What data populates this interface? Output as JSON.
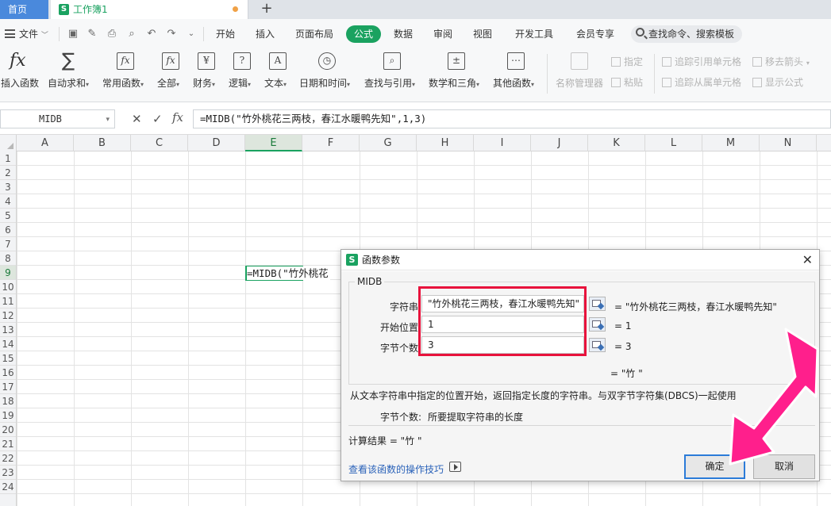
{
  "tabs": {
    "home": "首页",
    "doc_icon": "S",
    "doc_title": "工作簿1",
    "add": "+"
  },
  "menu": {
    "file": "文件",
    "items": [
      "开始",
      "插入",
      "页面布局",
      "公式",
      "数据",
      "审阅",
      "视图",
      "开发工具",
      "会员专享"
    ],
    "active_index": 3,
    "search_placeholder": "查找命令、搜索模板",
    "accent_color": "#1aa260"
  },
  "ribbon": {
    "insert_function": "插入函数",
    "autosum": "自动求和",
    "common": "常用函数",
    "all": "全部",
    "finance": "财务",
    "logic": "逻辑",
    "text": "文本",
    "datetime": "日期和时间",
    "lookup": "查找与引用",
    "math": "数学和三角",
    "other": "其他函数",
    "name_manager": "名称管理器",
    "specify": "指定",
    "paste": "粘贴",
    "trace_precedents": "追踪引用单元格",
    "remove_arrows": "移去箭头",
    "trace_dependents": "追踪从属单元格",
    "show_formulas": "显示公式"
  },
  "formula_bar": {
    "name_box": "MIDB",
    "formula": "=MIDB(\"竹外桃花三两枝，春江水暖鸭先知\",1,3)"
  },
  "sheet": {
    "columns": [
      "A",
      "B",
      "C",
      "D",
      "E",
      "F",
      "G",
      "H",
      "I",
      "J",
      "K",
      "L",
      "M",
      "N"
    ],
    "rows": [
      "1",
      "2",
      "3",
      "4",
      "5",
      "6",
      "7",
      "8",
      "9",
      "10",
      "11",
      "12",
      "13",
      "14",
      "15",
      "16",
      "17",
      "18",
      "19",
      "20",
      "21",
      "22",
      "23",
      "24"
    ],
    "active_col": "E",
    "active_row": "9",
    "active_cell_text": "=MIDB(\"竹外桃花"
  },
  "dialog": {
    "title": "函数参数",
    "function_name": "MIDB",
    "args": [
      {
        "label": "字符串",
        "value": "\"竹外桃花三两枝，春江水暖鸭先知\"",
        "result": "= \"竹外桃花三两枝，春江水暖鸭先知\""
      },
      {
        "label": "开始位置",
        "value": "1",
        "result": "= 1"
      },
      {
        "label": "字节个数",
        "value": "3",
        "result": "= 3"
      }
    ],
    "function_result": "= \"竹 \"",
    "description": "从文本字符串中指定的位置开始，返回指定长度的字符串。与双字节字符集(DBCS)一起使用",
    "arg_help_name": "字节个数:",
    "arg_help_text": "所要提取字符串的长度",
    "calc_result": "计算结果 = \"竹 \"",
    "help_link": "查看该函数的操作技巧",
    "ok": "确定",
    "cancel": "取消",
    "highlight_color": "#e8123c",
    "arrow_color": "#ff1f8c"
  }
}
